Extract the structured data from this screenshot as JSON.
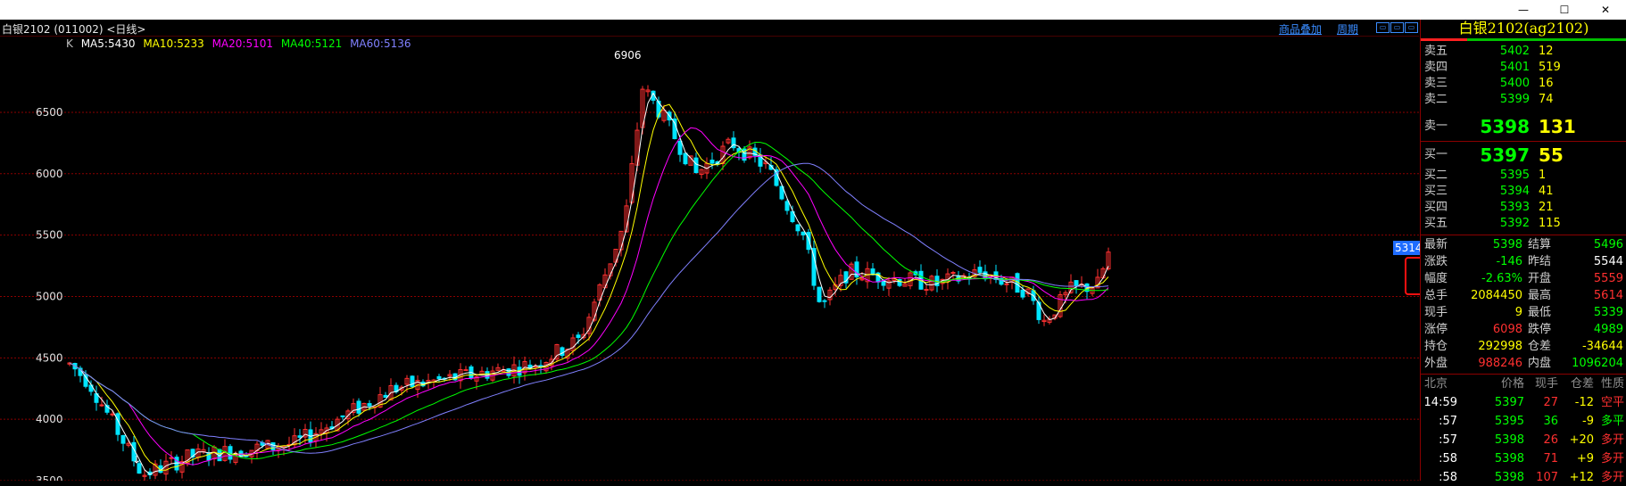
{
  "window": {
    "minimize": "—",
    "maximize": "☐",
    "close": "✕"
  },
  "toolbar": {
    "title": "白银2102 (011002) <日线>",
    "overlay_label": "商品叠加",
    "period_label": "周期"
  },
  "ma": {
    "k": "K",
    "ma5": "MA5:5430",
    "ma10": "MA10:5233",
    "ma20": "MA20:5101",
    "ma40": "MA40:5121",
    "ma60": "MA60:5136"
  },
  "chart_data": {
    "type": "candlestick",
    "y_ticks": [
      6500,
      6000,
      5500,
      5000,
      4500,
      4000,
      3500
    ],
    "ylim": [
      3500,
      6950
    ],
    "grid": "horizontal",
    "annotations": [
      {
        "text": "6906",
        "value": 6906
      },
      {
        "text": "↓",
        "value": 3640
      }
    ],
    "current_price_tag": "5314",
    "ma_lines": [
      {
        "name": "MA5",
        "color": "#ffffff"
      },
      {
        "name": "MA10",
        "color": "#ffff00"
      },
      {
        "name": "MA20",
        "color": "#ff00ff"
      },
      {
        "name": "MA40",
        "color": "#00ff00"
      },
      {
        "name": "MA60",
        "color": "#8080ff"
      }
    ]
  },
  "quote": {
    "title": "白银2102(ag2102)",
    "asks": [
      {
        "label": "卖五",
        "price": "5402",
        "vol": "12"
      },
      {
        "label": "卖四",
        "price": "5401",
        "vol": "519"
      },
      {
        "label": "卖三",
        "price": "5400",
        "vol": "16"
      },
      {
        "label": "卖二",
        "price": "5399",
        "vol": "74"
      }
    ],
    "ask1": {
      "label": "卖一",
      "price": "5398",
      "vol": "131"
    },
    "bid1": {
      "label": "买一",
      "price": "5397",
      "vol": "55"
    },
    "bids": [
      {
        "label": "买二",
        "price": "5395",
        "vol": "1"
      },
      {
        "label": "买三",
        "price": "5394",
        "vol": "41"
      },
      {
        "label": "买四",
        "price": "5393",
        "vol": "21"
      },
      {
        "label": "买五",
        "price": "5392",
        "vol": "115"
      }
    ],
    "stats": [
      {
        "l1": "最新",
        "v1": "5398",
        "c1": "#00ff00",
        "l2": "结算",
        "v2": "5496",
        "c2": "#00ff00"
      },
      {
        "l1": "涨跌",
        "v1": "-146",
        "c1": "#00ff00",
        "l2": "昨结",
        "v2": "5544",
        "c2": "#ffffff"
      },
      {
        "l1": "幅度",
        "v1": "-2.63%",
        "c1": "#00ff00",
        "l2": "开盘",
        "v2": "5559",
        "c2": "#ff3030"
      },
      {
        "l1": "总手",
        "v1": "2084450",
        "c1": "#ffff00",
        "l2": "最高",
        "v2": "5614",
        "c2": "#ff3030"
      },
      {
        "l1": "现手",
        "v1": "9",
        "c1": "#ffff00",
        "l2": "最低",
        "v2": "5339",
        "c2": "#00ff00"
      },
      {
        "l1": "涨停",
        "v1": "6098",
        "c1": "#ff3030",
        "l2": "跌停",
        "v2": "4989",
        "c2": "#00ff00"
      },
      {
        "l1": "持仓",
        "v1": "292998",
        "c1": "#ffff00",
        "l2": "仓差",
        "v2": "-34644",
        "c2": "#ffff00"
      },
      {
        "l1": "外盘",
        "v1": "988246",
        "c1": "#ff3030",
        "l2": "内盘",
        "v2": "1096204",
        "c2": "#00ff00"
      }
    ],
    "trades_header": {
      "loc": "北京",
      "price": "价格",
      "vol": "现手",
      "oi": "仓差",
      "nature": "性质"
    },
    "trades": [
      {
        "time": "14:59",
        "price": "5397",
        "vol": "27",
        "oi": "-12",
        "nature": "空平",
        "pc": "#00ff00",
        "vc": "#ff3030",
        "oc": "#ffff00",
        "nc": "#ff3030"
      },
      {
        "time": ":57",
        "price": "5395",
        "vol": "36",
        "oi": "-9",
        "nature": "多平",
        "pc": "#00ff00",
        "vc": "#00ff00",
        "oc": "#ffff00",
        "nc": "#00ff00"
      },
      {
        "time": ":57",
        "price": "5398",
        "vol": "26",
        "oi": "+20",
        "nature": "多开",
        "pc": "#00ff00",
        "vc": "#ff3030",
        "oc": "#ffff00",
        "nc": "#ff3030"
      },
      {
        "time": ":58",
        "price": "5398",
        "vol": "71",
        "oi": "+9",
        "nature": "多开",
        "pc": "#00ff00",
        "vc": "#ff3030",
        "oc": "#ffff00",
        "nc": "#ff3030"
      },
      {
        "time": ":58",
        "price": "5398",
        "vol": "107",
        "oi": "+12",
        "nature": "多开",
        "pc": "#00ff00",
        "vc": "#ff3030",
        "oc": "#ffff00",
        "nc": "#ff3030"
      }
    ]
  }
}
